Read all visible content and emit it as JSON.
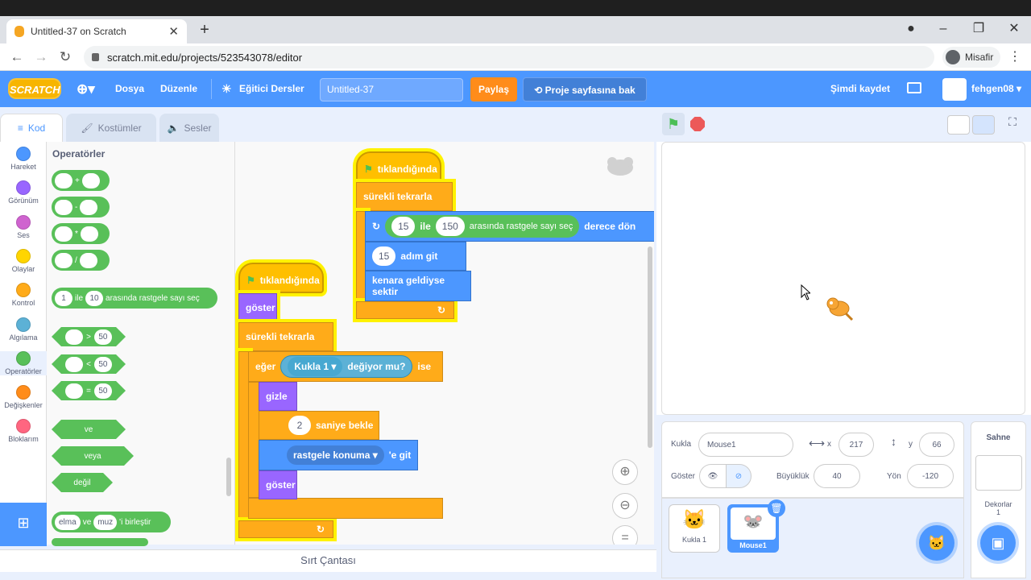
{
  "browser": {
    "tab_title": "Untitled-37 on Scratch",
    "url": "scratch.mit.edu/projects/523543078/editor",
    "profile_label": "Misafir"
  },
  "menu": {
    "logo": "SCRATCH",
    "file": "Dosya",
    "edit": "Düzenle",
    "tutorials": "Eğitici Dersler",
    "project_title": "Untitled-37",
    "share": "Paylaş",
    "see_project_page": "Proje sayfasına bak",
    "save_now": "Şimdi kaydet",
    "username": "fehgen08"
  },
  "tabs": {
    "code": "Kod",
    "costumes": "Kostümler",
    "sounds": "Sesler"
  },
  "categories": [
    {
      "label": "Hareket",
      "color": "#4c97ff"
    },
    {
      "label": "Görünüm",
      "color": "#9966ff"
    },
    {
      "label": "Ses",
      "color": "#cf63cf"
    },
    {
      "label": "Olaylar",
      "color": "#ffd500"
    },
    {
      "label": "Kontrol",
      "color": "#ffab19"
    },
    {
      "label": "Algılama",
      "color": "#5cb1d6"
    },
    {
      "label": "Operatörler",
      "color": "#59c059"
    },
    {
      "label": "Değişkenler",
      "color": "#ff8c1a"
    },
    {
      "label": "Bloklarım",
      "color": "#ff6680"
    }
  ],
  "palette": {
    "heading": "Operatörler",
    "ops": [
      "+",
      "-",
      "*",
      "/"
    ],
    "random": {
      "from": "1",
      "word": "ile",
      "to": "10",
      "suffix": "arasında rastgele sayı seç"
    },
    "compare": [
      {
        "op": ">",
        "val": "50"
      },
      {
        "op": "<",
        "val": "50"
      },
      {
        "op": "=",
        "val": "50"
      }
    ],
    "logic": [
      "ve",
      "veya",
      "değil"
    ],
    "join": {
      "a": "elma",
      "word": "ve",
      "b": "muz",
      "suffix": "'i birleştir"
    }
  },
  "script1": {
    "hat": "tıklandığında",
    "forever": "sürekli tekrarla",
    "turn": {
      "a": "15",
      "word": "ile",
      "b": "150",
      "mid": "arasında rastgele sayı seç",
      "suffix": "derece dön"
    },
    "move": {
      "val": "15",
      "label": "adım git"
    },
    "bounce": "kenara geldiyse sektir"
  },
  "script2": {
    "hat": "tıklandığında",
    "show": "göster",
    "forever": "sürekli tekrarla",
    "if": "eğer",
    "sprite": "Kukla 1",
    "touching": "değiyor mu?",
    "then": "ise",
    "hide": "gizle",
    "wait": {
      "val": "2",
      "label": "saniye bekle"
    },
    "goto": {
      "val": "rastgele konuma",
      "suffix": "'e git"
    },
    "show2": "göster"
  },
  "backpack": "Sırt Çantası",
  "sprite_info": {
    "sprite_label": "Kukla",
    "sprite_name": "Mouse1",
    "x_label": "x",
    "x": "217",
    "y_label": "y",
    "y": "66",
    "show_label": "Göster",
    "size_label": "Büyüklük",
    "size": "40",
    "direction_label": "Yön",
    "direction": "-120"
  },
  "sprites": [
    {
      "name": "Kukla 1"
    },
    {
      "name": "Mouse1"
    }
  ],
  "stage_panel": {
    "title": "Sahne",
    "backdrops_label": "Dekorlar",
    "backdrop_count": "1"
  }
}
